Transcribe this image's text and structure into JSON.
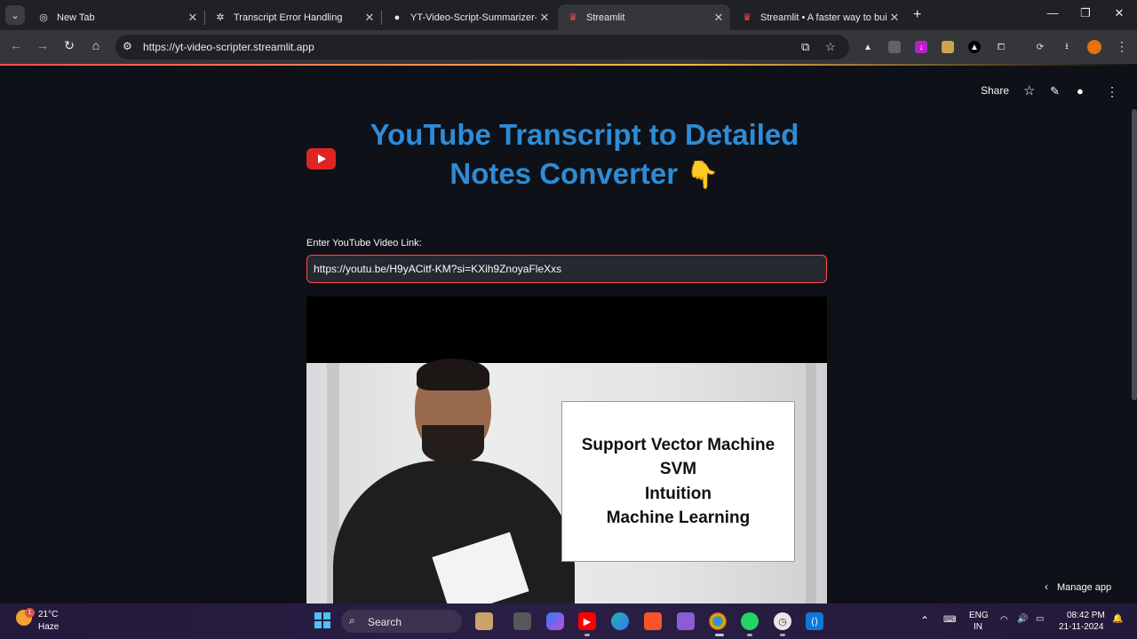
{
  "browser": {
    "tabs": [
      {
        "title": "New Tab",
        "icon": "chrome-icon"
      },
      {
        "title": "Transcript Error Handling",
        "icon": "openai-icon"
      },
      {
        "title": "YT-Video-Script-Summarizer-/R",
        "icon": "github-icon"
      },
      {
        "title": "Streamlit",
        "icon": "streamlit-icon"
      },
      {
        "title": "Streamlit • A faster way to build",
        "icon": "streamlit-icon"
      }
    ],
    "url": "https://yt-video-scripter.streamlit.app"
  },
  "app": {
    "header": {
      "share_label": "Share"
    },
    "title_line1": "YouTube Transcript to Detailed",
    "title_line2": "Notes Converter",
    "title_emoji": "👇",
    "input_label": "Enter YouTube Video Link:",
    "input_value": "https://youtu.be/H9yACitf-KM?si=KXih9ZnoyaFleXxs",
    "video_board": [
      "Support Vector Machine",
      "SVM",
      "Intuition",
      "Machine Learning"
    ],
    "manage_label": "Manage app"
  },
  "taskbar": {
    "weather_badge": "1",
    "weather_temp": "21°C",
    "weather_cond": "Haze",
    "search_label": "Search",
    "lang_line1": "ENG",
    "lang_line2": "IN",
    "time": "08:42 PM",
    "date": "21-11-2024"
  },
  "colors": {
    "title": "#2e8bd6",
    "accent": "#ff4b4b",
    "background": "#0e1117"
  }
}
